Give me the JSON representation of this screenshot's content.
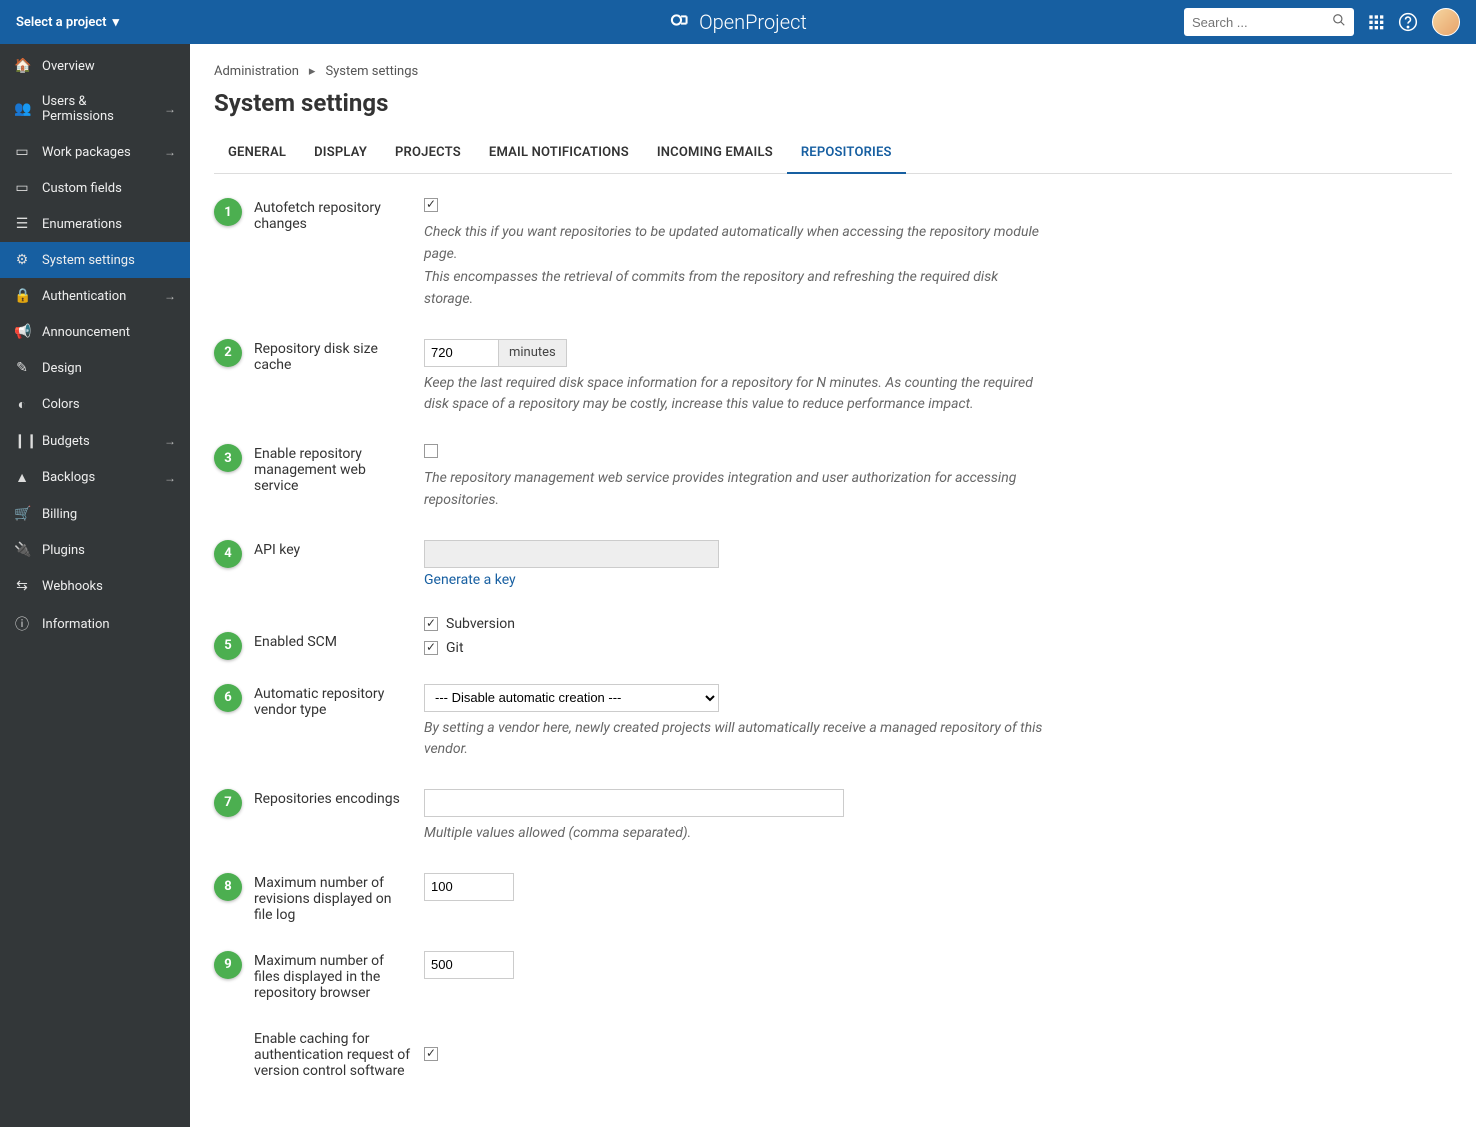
{
  "topbar": {
    "project_select": "Select a project",
    "brand": "OpenProject",
    "search_placeholder": "Search ..."
  },
  "sidebar": {
    "items": [
      {
        "icon": "🏠",
        "label": "Overview",
        "arrow": false
      },
      {
        "icon": "👥",
        "label": "Users & Permissions",
        "arrow": true
      },
      {
        "icon": "▭",
        "label": "Work packages",
        "arrow": true
      },
      {
        "icon": "▭",
        "label": "Custom fields",
        "arrow": false
      },
      {
        "icon": "☰",
        "label": "Enumerations",
        "arrow": false
      },
      {
        "icon": "⚙",
        "label": "System settings",
        "arrow": false,
        "active": true
      },
      {
        "icon": "🔒",
        "label": "Authentication",
        "arrow": true
      },
      {
        "icon": "📢",
        "label": "Announcement",
        "arrow": false
      },
      {
        "icon": "✎",
        "label": "Design",
        "arrow": false
      },
      {
        "icon": "◐",
        "label": "Colors",
        "arrow": false
      },
      {
        "icon": "❙❙",
        "label": "Budgets",
        "arrow": true
      },
      {
        "icon": "▲",
        "label": "Backlogs",
        "arrow": true
      },
      {
        "icon": "🛒",
        "label": "Billing",
        "arrow": false
      },
      {
        "icon": "🔌",
        "label": "Plugins",
        "arrow": false
      },
      {
        "icon": "⇆",
        "label": "Webhooks",
        "arrow": false
      },
      {
        "icon": "ⓘ",
        "label": "Information",
        "arrow": false
      }
    ]
  },
  "breadcrumb": {
    "root": "Administration",
    "current": "System settings"
  },
  "page": {
    "title": "System settings"
  },
  "tabs": [
    {
      "id": "general",
      "label": "GENERAL"
    },
    {
      "id": "display",
      "label": "DISPLAY"
    },
    {
      "id": "projects",
      "label": "PROJECTS"
    },
    {
      "id": "email-notifications",
      "label": "EMAIL NOTIFICATIONS"
    },
    {
      "id": "incoming-emails",
      "label": "INCOMING EMAILS"
    },
    {
      "id": "repositories",
      "label": "REPOSITORIES",
      "active": true
    }
  ],
  "steps": [
    "1",
    "2",
    "3",
    "4",
    "5",
    "6",
    "7",
    "8",
    "9"
  ],
  "form": {
    "autofetch": {
      "label": "Autofetch repository changes",
      "checked": true,
      "help1": "Check this if you want repositories to be updated automatically when accessing the repository module page.",
      "help2": "This encompasses the retrieval of commits from the repository and refreshing the required disk storage."
    },
    "cache": {
      "label": "Repository disk size cache",
      "value": "720",
      "unit": "minutes",
      "help": "Keep the last required disk space information for a repository for N minutes. As counting the required disk space of a repository may be costly, increase this value to reduce performance impact."
    },
    "webservice": {
      "label": "Enable repository management web service",
      "checked": false,
      "help": "The repository management web service provides integration and user authorization for accessing repositories."
    },
    "apikey": {
      "label": "API key",
      "value": "",
      "link": "Generate a key"
    },
    "scm": {
      "label": "Enabled SCM",
      "options": [
        {
          "label": "Subversion",
          "checked": true
        },
        {
          "label": "Git",
          "checked": true
        }
      ]
    },
    "vendor": {
      "label": "Automatic repository vendor type",
      "selected": "--- Disable automatic creation ---",
      "help": "By setting a vendor here, newly created projects will automatically receive a managed repository of this vendor."
    },
    "encodings": {
      "label": "Repositories encodings",
      "value": "",
      "help": "Multiple values allowed (comma separated)."
    },
    "max_revisions": {
      "label": "Maximum number of revisions displayed on file log",
      "value": "100"
    },
    "max_files": {
      "label": "Maximum number of files displayed in the repository browser",
      "value": "500"
    },
    "caching": {
      "label": "Enable caching for authentication request of version control software",
      "checked": true
    }
  }
}
